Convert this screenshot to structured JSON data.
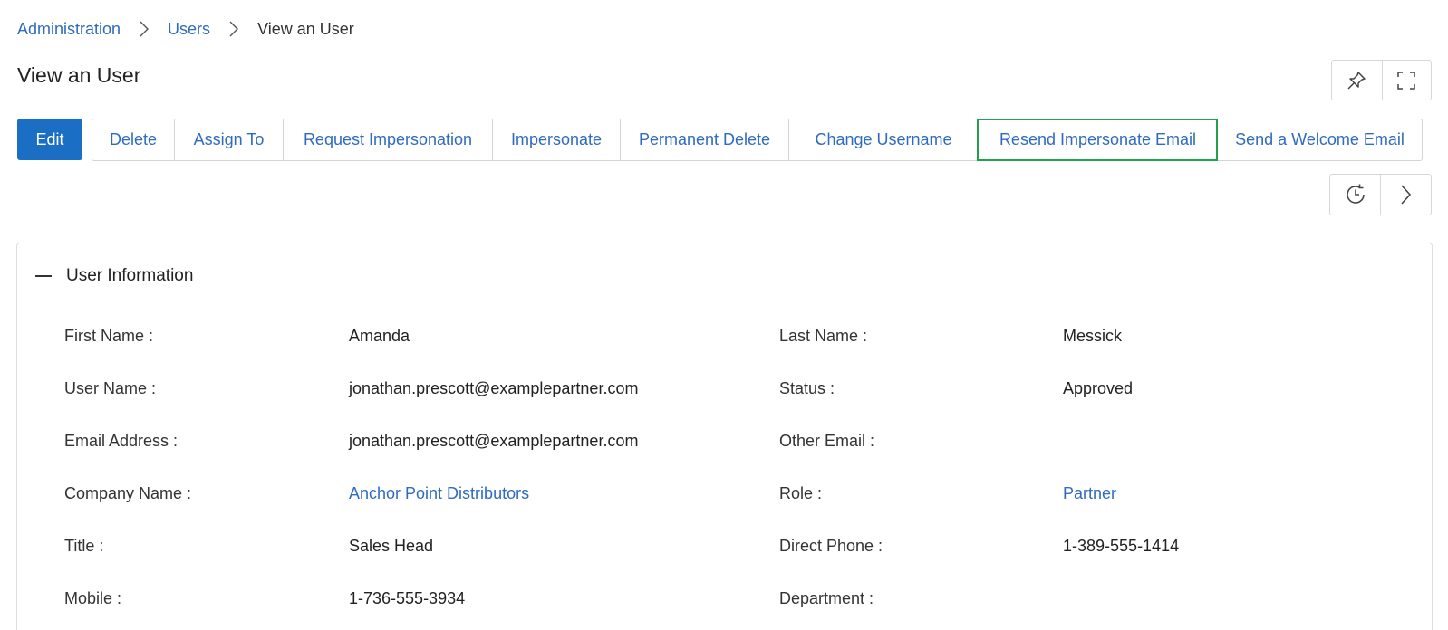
{
  "breadcrumb": {
    "items": [
      "Administration",
      "Users"
    ],
    "current": "View an User"
  },
  "page": {
    "title": "View an User"
  },
  "toolbar": {
    "icons": [
      "pin-icon",
      "fullscreen-icon"
    ],
    "nav_icons": [
      "history-icon",
      "chevron-right-icon"
    ]
  },
  "actions": {
    "edit": "Edit",
    "buttons": [
      "Delete",
      "Assign To",
      "Request Impersonation",
      "Impersonate",
      "Permanent Delete",
      "Change Username",
      "Resend Impersonate Email",
      "Send a Welcome Email"
    ]
  },
  "panel": {
    "title": "User Information",
    "fields": [
      {
        "label": "First Name :",
        "value": "Amanda"
      },
      {
        "label": "Last Name :",
        "value": "Messick"
      },
      {
        "label": "User Name :",
        "value": "jonathan.prescott@examplepartner.com"
      },
      {
        "label": "Status :",
        "value": "Approved"
      },
      {
        "label": "Email Address :",
        "value": "jonathan.prescott@examplepartner.com"
      },
      {
        "label": "Other Email :",
        "value": ""
      },
      {
        "label": "Company Name :",
        "value": "Anchor Point Distributors"
      },
      {
        "label": "Role :",
        "value": "Partner"
      },
      {
        "label": "Title :",
        "value": "Sales Head"
      },
      {
        "label": "Direct Phone :",
        "value": "1-389-555-1414"
      },
      {
        "label": "Mobile :",
        "value": "1-736-555-3934"
      },
      {
        "label": "Department :",
        "value": ""
      }
    ]
  },
  "colors": {
    "accent": "#1a6fc4",
    "link": "#2f6bbf",
    "highlight": "#22a04b"
  }
}
